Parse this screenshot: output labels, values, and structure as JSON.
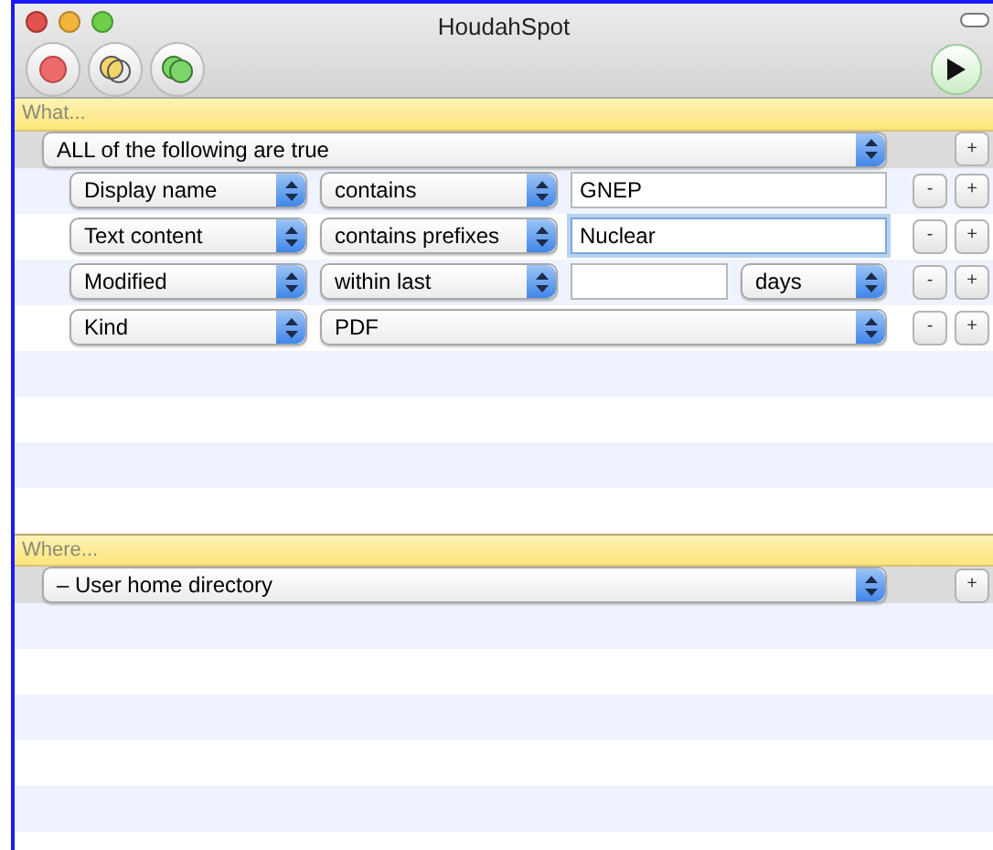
{
  "window": {
    "title": "HoudahSpot"
  },
  "what": {
    "header": "What...",
    "match": {
      "value": "ALL of the following are true",
      "add": "+"
    },
    "criteria": [
      {
        "kind": "text",
        "attribute": "Display name",
        "operator": "contains",
        "value": "GNEP",
        "focused": false,
        "remove": "-",
        "add": "+"
      },
      {
        "kind": "text",
        "attribute": "Text content",
        "operator": "contains prefixes",
        "value": "Nuclear",
        "focused": true,
        "remove": "-",
        "add": "+"
      },
      {
        "kind": "number",
        "attribute": "Modified",
        "operator": "within last",
        "unit": "days",
        "remove": "-",
        "add": "+"
      },
      {
        "kind": "choice",
        "attribute": "Kind",
        "operator": "PDF",
        "remove": "-",
        "add": "+"
      }
    ]
  },
  "where": {
    "header": "Where...",
    "location": {
      "value": "– User home directory",
      "add": "+"
    }
  }
}
